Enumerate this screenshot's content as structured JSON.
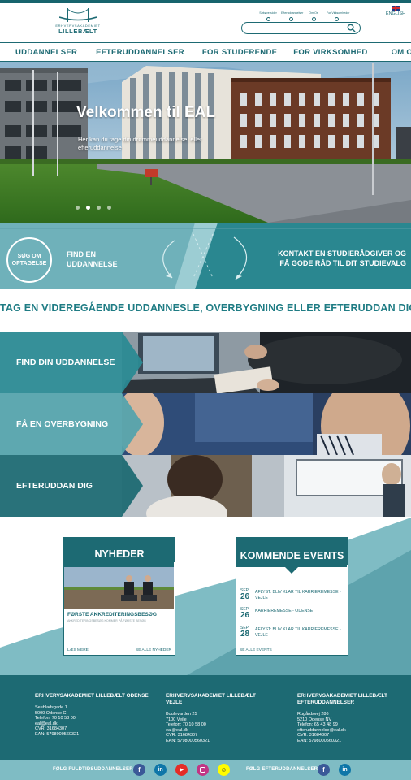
{
  "header": {
    "logo_line1": "ERHVERVSAKADEMIET",
    "logo_line2": "LILLEBÆLT",
    "quick_links": [
      "Søbøversider",
      "Efteruddannelser",
      "Om Os",
      "For Virksomheder"
    ],
    "language": "ENGLISH",
    "search_placeholder": ""
  },
  "nav": {
    "items": [
      "UDDANNELSER",
      "EFTERUDDANNELSER",
      "FOR STUDERENDE",
      "FOR VIRKSOMHED",
      "OM OS"
    ]
  },
  "hero": {
    "title": "Velkommen til EAL",
    "subtitle": "Her kan du tage din drømmeuddannelse, eller efteruddannelse",
    "slide_count": 4,
    "active_slide": 2
  },
  "cta": {
    "badge": "SØG OM OPTAGELSE",
    "find": "FIND EN UDDANNELSE",
    "contact": "KONTAKT EN STUDIERÅDGIVER OG FÅ GODE RÅD TIL DIT STUDIEVALG"
  },
  "headline": "TAG EN VIDEREGÅENDE UDDANNESLE, OVERBYGNING ELLER EFTERUDDAN DIG",
  "features": [
    {
      "label": "FIND DIN UDDANNELSE"
    },
    {
      "label": "FÅ EN OVERBYGNING"
    },
    {
      "label": "EFTERUDDAN DIG"
    }
  ],
  "news": {
    "title": "NYHEDER",
    "headline": "FØRSTE AKKREDITERINGSBESØG",
    "teaser": "AKKREDITERINGSBESØG KOMMER PÅ FØRSTE BESØG",
    "read_more": "LÆS MERE",
    "see_all": "SE ALLE NYHEDER"
  },
  "events": {
    "title": "KOMMENDE EVENTS",
    "items": [
      {
        "month": "SEP",
        "day": "26",
        "text": "AFLYST: BLIV KLAR TIL KARRIEREMESSE - VEJLE"
      },
      {
        "month": "SEP",
        "day": "26",
        "text": "KARRIEREMESSE - ODENSE"
      },
      {
        "month": "SEP",
        "day": "28",
        "text": "AFLYST: BLIV KLAR TIL KARRIEREMESSE - VEJLE"
      }
    ],
    "see_all": "SE ALLE EVENTS"
  },
  "footer": {
    "columns": [
      {
        "title": "ERHVERVSAKADEMIET LILLEBÆLT ODENSE",
        "lines": [
          "Seebladsgade 1",
          "5000 Odense C",
          "Telefon: 70 10 58 00",
          "eal@eal.dk",
          "CVR: 31684307",
          "EAN: 5798000560321"
        ]
      },
      {
        "title": "ERHVERVSAKADEMIET LILLEBÆLT VEJLE",
        "lines": [
          "Boulevarden 25",
          "7100 Vejle",
          "Telefon: 70 10 58 00",
          "eal@eal.dk",
          "CVR: 31684307",
          "EAN: 5798000560321"
        ]
      },
      {
        "title": "ERHVERVSAKADEMIET LILLEBÆLT EFTERUDDANNELSER",
        "lines": [
          "Rugårdsvej 286",
          "5210 Odense NV",
          "Telefon: 65 43 48 99",
          "efteruddannelse@eal.dk",
          "CVR: 31684307",
          "EAN: 5798000560321"
        ]
      }
    ]
  },
  "social": {
    "fulltime_label": "FØLG FULDTIDSUDDANNELSER",
    "continuing_label": "FØLG EFTERUDDANNELSER",
    "fulltime_icons": [
      "facebook-icon",
      "linkedin-icon",
      "youtube-icon",
      "instagram-icon",
      "snapchat-icon"
    ],
    "continuing_icons": [
      "facebook-icon",
      "linkedin-icon"
    ],
    "colors": {
      "facebook": "#3b5998",
      "linkedin": "#0e76a8",
      "youtube": "#e52d27",
      "instagram": "#c13584",
      "snapchat": "#fffc00"
    }
  },
  "colors": {
    "primary": "#1d6a73",
    "accent": "#7fbcc4",
    "headline": "#1f7c84"
  }
}
